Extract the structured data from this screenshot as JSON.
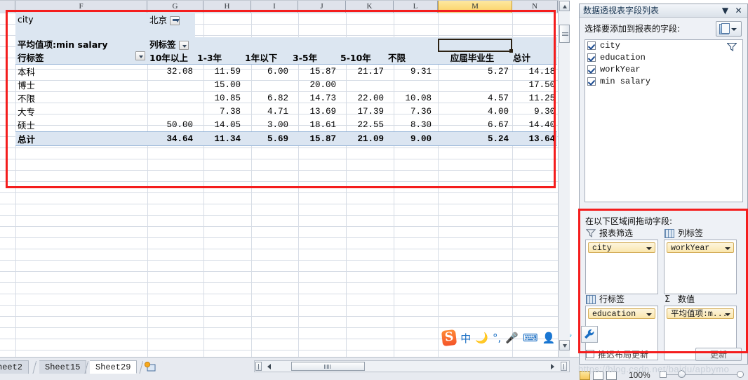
{
  "grid": {
    "column_headers": [
      "F",
      "G",
      "H",
      "I",
      "J",
      "K",
      "L",
      "M",
      "N"
    ],
    "active_column": "M"
  },
  "pivot": {
    "filter_label": "city",
    "filter_value": "北京",
    "value_caption": "平均值项:min salary",
    "column_labels_caption": "列标签",
    "row_labels_caption": "行标签",
    "columns": [
      "10年以上",
      "1-3年",
      "1年以下",
      "3-5年",
      "5-10年",
      "不限",
      "应届毕业生",
      "总计"
    ],
    "rows": [
      {
        "label": "本科",
        "values": [
          "32.08",
          "11.59",
          "6.00",
          "15.87",
          "21.17",
          "9.31",
          "5.27",
          "14.18"
        ]
      },
      {
        "label": "博士",
        "values": [
          "",
          "15.00",
          "",
          "20.00",
          "",
          "",
          "",
          "17.50"
        ]
      },
      {
        "label": "不限",
        "values": [
          "",
          "10.85",
          "6.82",
          "14.73",
          "22.00",
          "10.08",
          "4.57",
          "11.25"
        ]
      },
      {
        "label": "大专",
        "values": [
          "",
          "7.38",
          "4.71",
          "13.69",
          "17.39",
          "7.36",
          "4.00",
          "9.30"
        ]
      },
      {
        "label": "硕士",
        "values": [
          "50.00",
          "14.05",
          "3.00",
          "18.61",
          "22.55",
          "8.30",
          "6.67",
          "14.40"
        ]
      }
    ],
    "total_row": {
      "label": "总计",
      "values": [
        "34.64",
        "11.34",
        "5.69",
        "15.87",
        "21.09",
        "9.00",
        "5.24",
        "13.64"
      ]
    }
  },
  "field_panel": {
    "title": "数据透视表字段列表",
    "minimize_glyph": "▼",
    "close_glyph": "✕",
    "subtitle": "选择要添加到报表的字段:",
    "fields": [
      "city",
      "education",
      "workYear",
      "min salary"
    ],
    "areas_title": "在以下区域间拖动字段:",
    "zones": [
      {
        "name": "报表筛选",
        "icon": "filter-icon",
        "chip": "city"
      },
      {
        "name": "列标签",
        "icon": "grid-icon",
        "chip": "workYear"
      },
      {
        "name": "行标签",
        "icon": "grid-icon",
        "chip": "education"
      },
      {
        "name": "数值",
        "icon": "sigma-icon",
        "chip": "平均值项:m..."
      }
    ],
    "defer_label": "推迟布局更新",
    "update_label": "更新"
  },
  "sheet_tabs": {
    "tabs": [
      "heet2",
      "Sheet15",
      "Sheet29"
    ],
    "selected": "Sheet29"
  },
  "ime": {
    "logo": "S",
    "items": [
      "中",
      "moon-icon",
      "punctuation-icon",
      "mic-icon",
      "keyboard-icon",
      "user-icon",
      "shirt-icon",
      "wrench-icon"
    ]
  },
  "status_bar": {
    "zoom": "100%"
  },
  "watermark": "https://blog.csdn.net/baidu/apbymo",
  "colors": {
    "pivot_band": "#dce6f1",
    "accent_red": "#f41d1d",
    "active_col": "#fcd265",
    "chip": "#fae6ad"
  }
}
